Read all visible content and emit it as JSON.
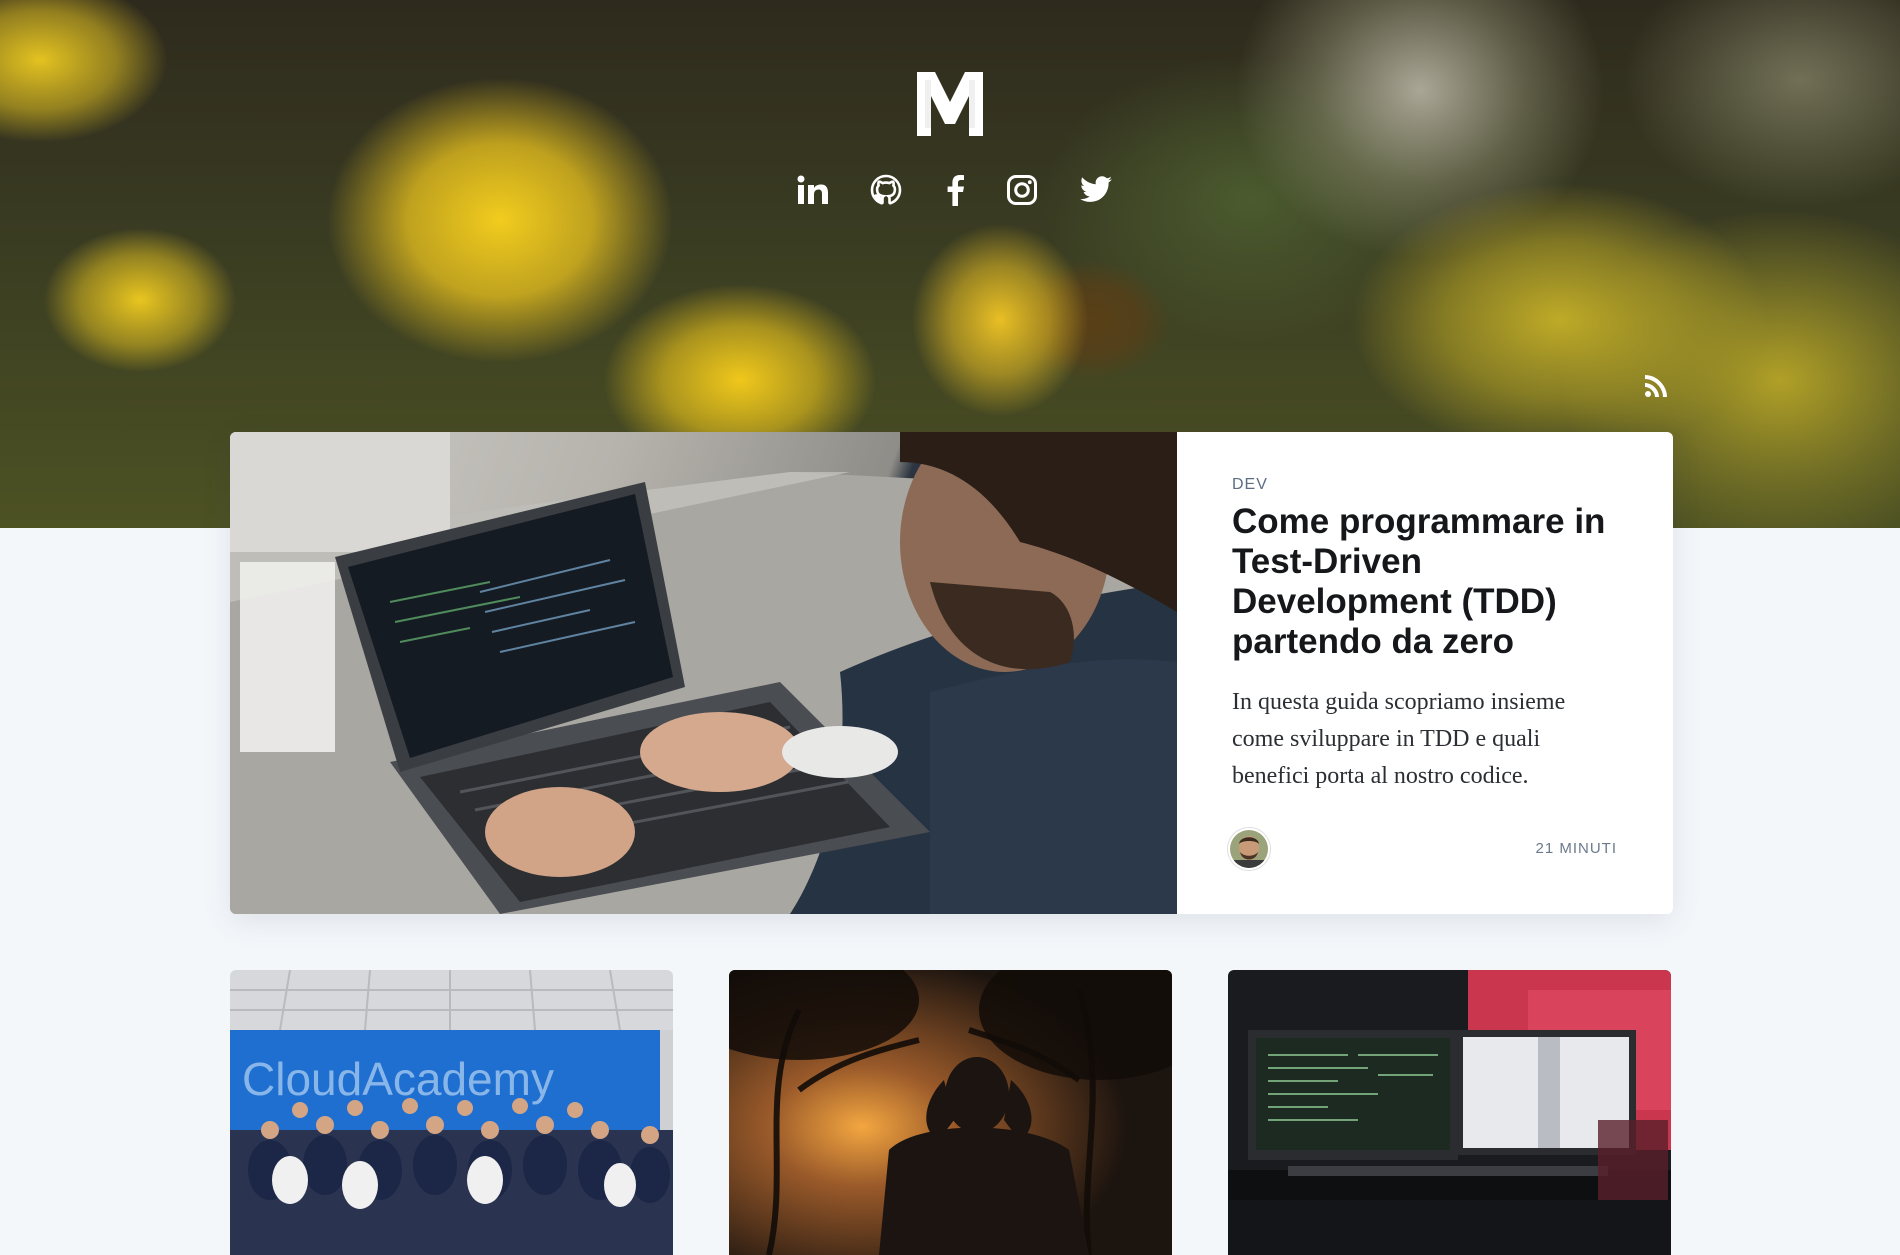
{
  "site": {
    "logo_letter": "M",
    "social": [
      {
        "icon": "linkedin-icon",
        "label": "in"
      },
      {
        "icon": "github-icon"
      },
      {
        "icon": "facebook-icon",
        "label": "f"
      },
      {
        "icon": "instagram-icon"
      },
      {
        "icon": "twitter-icon"
      }
    ],
    "rss_icon": "rss-icon"
  },
  "featured": {
    "category": "DEV",
    "title": "Come programmare in Test-Driven Development (TDD) partendo da zero",
    "excerpt": "In questa guida scopriamo insieme come sviluppare in TDD e quali benefici porta al nostro codice.",
    "reading_time": "21 MINUTI"
  },
  "cards": [
    {
      "image": "team-photo",
      "banner_text": "CloudAcademy"
    },
    {
      "image": "sunset-silhouette"
    },
    {
      "image": "dual-monitor-desk"
    }
  ],
  "colors": {
    "background": "#f4f7fa",
    "category": "#5d6d82",
    "title": "#15171a"
  }
}
